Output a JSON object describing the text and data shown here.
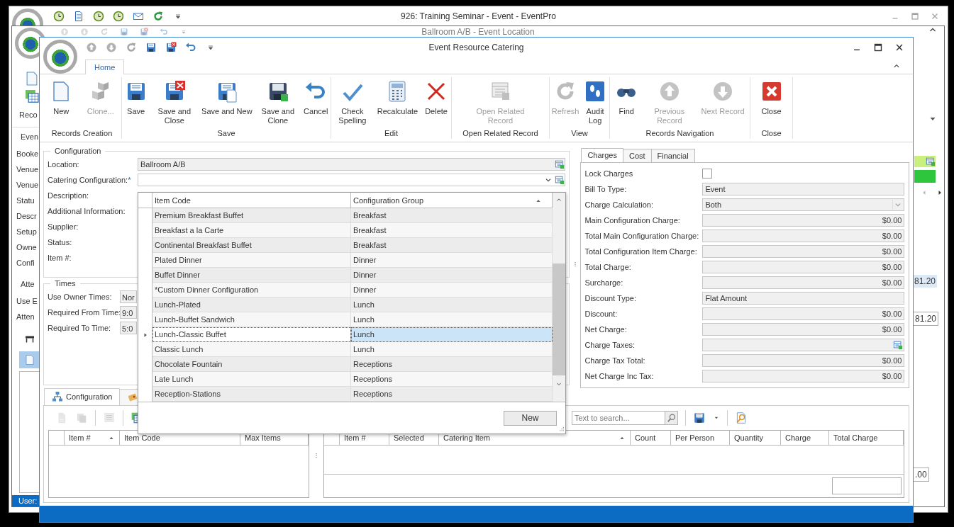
{
  "back_window": {
    "title": "926: Training Seminar - Event - EventPro"
  },
  "middle_window": {
    "title": "Ballroom A/B - Event Location",
    "ribbon_label": "Reco",
    "group_label": "Even",
    "field_labels": [
      "Booke",
      "Venue",
      "Venue",
      "Statu",
      "Descr",
      "Setup",
      "Owne",
      "Confi"
    ],
    "group2_label": "Atte",
    "field2_labels": [
      "Use E",
      "Atten"
    ],
    "side_values": [
      {
        "text": "81.20",
        "kind": "row"
      },
      {
        "text": "81.20",
        "kind": "field"
      },
      {
        "text": ".00",
        "kind": "field"
      }
    ],
    "status_user": "User:"
  },
  "window": {
    "title": "Event Resource Catering",
    "tabs": [
      {
        "label": "Home",
        "selected": true
      }
    ],
    "ribbon": [
      {
        "label": "Records Creation",
        "buttons": [
          {
            "label": "New",
            "disabled": false
          },
          {
            "label": "Clone...",
            "disabled": true
          }
        ]
      },
      {
        "label": "Save",
        "buttons": [
          {
            "label": "Save",
            "disabled": false
          },
          {
            "label": "Save and Close",
            "disabled": false
          },
          {
            "label": "Save and New",
            "disabled": false
          },
          {
            "label": "Save and Clone",
            "disabled": false
          },
          {
            "label": "Cancel",
            "disabled": false
          }
        ]
      },
      {
        "label": "Edit",
        "buttons": [
          {
            "label": "Check Spelling",
            "disabled": false
          },
          {
            "label": "Recalculate",
            "disabled": false
          },
          {
            "label": "Delete",
            "disabled": false
          }
        ]
      },
      {
        "label": "Open Related Record",
        "buttons": [
          {
            "label": "Open Related Record",
            "disabled": true
          }
        ]
      },
      {
        "label": "View",
        "buttons": [
          {
            "label": "Refresh",
            "disabled": true
          },
          {
            "label": "Audit Log",
            "disabled": false
          }
        ]
      },
      {
        "label": "Records Navigation",
        "buttons": [
          {
            "label": "Find",
            "disabled": false
          },
          {
            "label": "Previous Record",
            "disabled": true
          },
          {
            "label": "Next Record",
            "disabled": true
          }
        ]
      },
      {
        "label": "Close",
        "buttons": [
          {
            "label": "Close",
            "disabled": false
          }
        ]
      }
    ]
  },
  "configuration": {
    "legend": "Configuration",
    "fields": [
      {
        "label": "Location:",
        "kind": "lookup",
        "value": "Ballroom A/B"
      },
      {
        "label": "Catering Configuration:",
        "mark": "*",
        "kind": "combo"
      },
      {
        "label": "Description:",
        "kind": "label"
      },
      {
        "label": "Additional Information:",
        "kind": "label"
      },
      {
        "label": "Supplier:",
        "kind": "label"
      },
      {
        "label": "Status:",
        "kind": "label"
      },
      {
        "label": "Item #:",
        "kind": "label"
      }
    ]
  },
  "times": {
    "legend": "Times",
    "fields": [
      {
        "label": "Use Owner Times:",
        "value": "Nor"
      },
      {
        "label": "Required From Time:",
        "value": "9:0"
      },
      {
        "label": "Required To Time:",
        "value": "5:0"
      }
    ]
  },
  "charges_panel": {
    "tabs": [
      {
        "label": "Charges",
        "selected": true
      },
      {
        "label": "Cost",
        "selected": false
      },
      {
        "label": "Financial",
        "selected": false
      }
    ],
    "fields": [
      {
        "label": "Lock Charges",
        "kind": "checkbox",
        "checked": false
      },
      {
        "label": "Bill To Type:",
        "kind": "text",
        "value": "Event"
      },
      {
        "label": "Charge Calculation:",
        "kind": "dropdown",
        "value": "Both"
      },
      {
        "label": "Main Configuration Charge:",
        "kind": "money",
        "value": "$0.00"
      },
      {
        "label": "Total Main Configuration Charge:",
        "kind": "money",
        "value": "$0.00"
      },
      {
        "label": "Total Configuration Item Charge:",
        "kind": "money",
        "value": "$0.00"
      },
      {
        "label": "Total Charge:",
        "kind": "money",
        "value": "$0.00"
      },
      {
        "label": "Surcharge:",
        "kind": "money",
        "value": "$0.00"
      },
      {
        "label": "Discount Type:",
        "kind": "text",
        "value": "Flat Amount"
      },
      {
        "label": "Discount:",
        "kind": "money",
        "value": "$0.00"
      },
      {
        "label": "Net Charge:",
        "kind": "money",
        "value": "$0.00"
      },
      {
        "label": "Charge Taxes:",
        "kind": "lookup"
      },
      {
        "label": "Charge Tax Total:",
        "kind": "money",
        "value": "$0.00"
      },
      {
        "label": "Net Charge Inc Tax:",
        "kind": "money",
        "value": "$0.00"
      }
    ]
  },
  "bottom_tabs": [
    {
      "label": "Configuration",
      "selected": true
    },
    {
      "selected": false
    }
  ],
  "config_grid": {
    "columns": [
      {
        "label": "Item #",
        "sorted": true
      },
      {
        "label": "Item Code",
        "sorted": false
      },
      {
        "label": "Max Items",
        "sorted": false
      }
    ]
  },
  "search": {
    "placeholder": "Text to search..."
  },
  "items_grid": {
    "columns": [
      {
        "label": "Item #",
        "sorted": false
      },
      {
        "label": "Selected",
        "sorted": false
      },
      {
        "label": "Catering Item",
        "sorted": true
      },
      {
        "label": "Count",
        "sorted": false
      },
      {
        "label": "Per Person",
        "sorted": false
      },
      {
        "label": "Quantity",
        "sorted": false
      },
      {
        "label": "Charge",
        "sorted": false
      },
      {
        "label": "Total Charge",
        "sorted": false
      }
    ]
  },
  "popup": {
    "columns": [
      {
        "label": "Item Code",
        "sorted": false
      },
      {
        "label": "Configuration Group",
        "sorted": true
      }
    ],
    "rows": [
      {
        "item_code": "Premium Breakfast Buffet",
        "group": "Breakfast",
        "selected": false
      },
      {
        "item_code": "Breakfast a la Carte",
        "group": "Breakfast",
        "selected": false
      },
      {
        "item_code": "Continental Breakfast Buffet",
        "group": "Breakfast",
        "selected": false
      },
      {
        "item_code": "Plated Dinner",
        "group": "Dinner",
        "selected": false
      },
      {
        "item_code": "Buffet Dinner",
        "group": "Dinner",
        "selected": false
      },
      {
        "item_code": "*Custom Dinner Configuration",
        "group": "Dinner",
        "selected": false
      },
      {
        "item_code": "Lunch-Plated",
        "group": "Lunch",
        "selected": false
      },
      {
        "item_code": "Lunch-Buffet Sandwich",
        "group": "Lunch",
        "selected": false
      },
      {
        "item_code": "Lunch-Classic Buffet",
        "group": "Lunch",
        "selected": true
      },
      {
        "item_code": "Classic Lunch",
        "group": "Lunch",
        "selected": false
      },
      {
        "item_code": "Chocolate Fountain",
        "group": "Receptions",
        "selected": false
      },
      {
        "item_code": "Late Lunch",
        "group": "Receptions",
        "selected": false
      },
      {
        "item_code": "Reception-Stations",
        "group": "Receptions",
        "selected": false
      }
    ],
    "button": "New"
  }
}
